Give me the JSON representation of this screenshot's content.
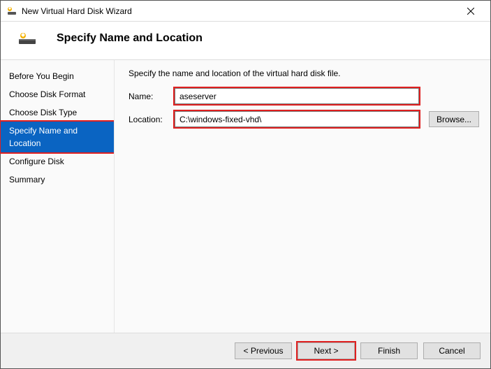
{
  "window": {
    "title": "New Virtual Hard Disk Wizard"
  },
  "header": {
    "title": "Specify Name and Location"
  },
  "sidebar": {
    "steps": [
      {
        "label": "Before You Begin"
      },
      {
        "label": "Choose Disk Format"
      },
      {
        "label": "Choose Disk Type"
      },
      {
        "label": "Specify Name and Location"
      },
      {
        "label": "Configure Disk"
      },
      {
        "label": "Summary"
      }
    ],
    "active_index": 3
  },
  "content": {
    "instruction": "Specify the name and location of the virtual hard disk file.",
    "name_label": "Name:",
    "name_value": "aseserver",
    "location_label": "Location:",
    "location_value": "C:\\windows-fixed-vhd\\",
    "browse_label": "Browse..."
  },
  "footer": {
    "previous": "< Previous",
    "next": "Next >",
    "finish": "Finish",
    "cancel": "Cancel"
  }
}
